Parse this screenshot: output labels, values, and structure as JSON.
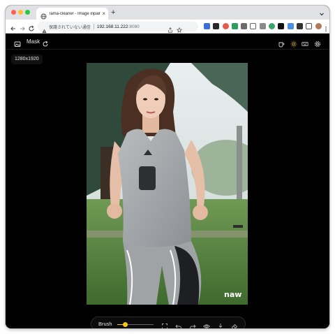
{
  "browser": {
    "tab_title": "lama-cleaner - Image inpainting",
    "new_tab_symbol": "+",
    "tab_close_symbol": "×",
    "security_text": "保護されていない通信",
    "url_host": "192.168.11.222",
    "url_port": ":8080"
  },
  "app": {
    "mask_label": "Mask",
    "image_resolution": "1280x1920",
    "accent_color": "#f5c518"
  },
  "photo": {
    "watermark_text": "naw"
  },
  "brush_toolbar": {
    "label": "Brush",
    "slider_value_percent": 22
  },
  "icons": {
    "header_left": [
      "image-icon",
      "reset-icon"
    ],
    "header_right": [
      "coffee-icon",
      "theme-sun-icon",
      "keyboard-icon",
      "settings-icon"
    ],
    "bottom": [
      "zoom-fit-icon",
      "undo-icon",
      "redo-icon",
      "eye-icon",
      "download-icon",
      "eraser-icon"
    ]
  }
}
